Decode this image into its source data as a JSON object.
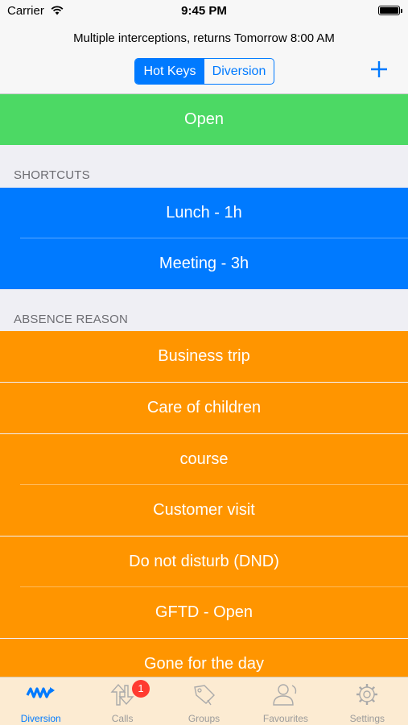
{
  "status_bar": {
    "carrier": "Carrier",
    "time": "9:45 PM"
  },
  "nav": {
    "subtitle": "Multiple interceptions, returns Tomorrow 8:00 AM",
    "segments": [
      "Hot Keys",
      "Diversion"
    ],
    "selected_segment": "Hot Keys",
    "add_icon": "plus-icon"
  },
  "open_row": {
    "label": "Open",
    "color": "#4cd964"
  },
  "shortcuts": {
    "header": "SHORTCUTS",
    "color": "#007aff",
    "items": [
      "Lunch - 1h",
      "Meeting - 3h"
    ]
  },
  "absence": {
    "header": "ABSENCE REASON",
    "color": "#ff9500",
    "items": [
      "Business trip",
      "Care of children",
      "course",
      "Customer visit",
      "Do not disturb (DND)",
      "GFTD - Open",
      "Gone for the day"
    ]
  },
  "tabbar": {
    "tabs": [
      {
        "label": "Diversion",
        "icon": "diversion-icon",
        "active": true
      },
      {
        "label": "Calls",
        "icon": "calls-icon",
        "badge": "1"
      },
      {
        "label": "Groups",
        "icon": "groups-icon"
      },
      {
        "label": "Favourites",
        "icon": "favourites-icon"
      },
      {
        "label": "Settings",
        "icon": "settings-icon"
      }
    ],
    "active_color": "#007aff",
    "background": "#fcebd2"
  }
}
